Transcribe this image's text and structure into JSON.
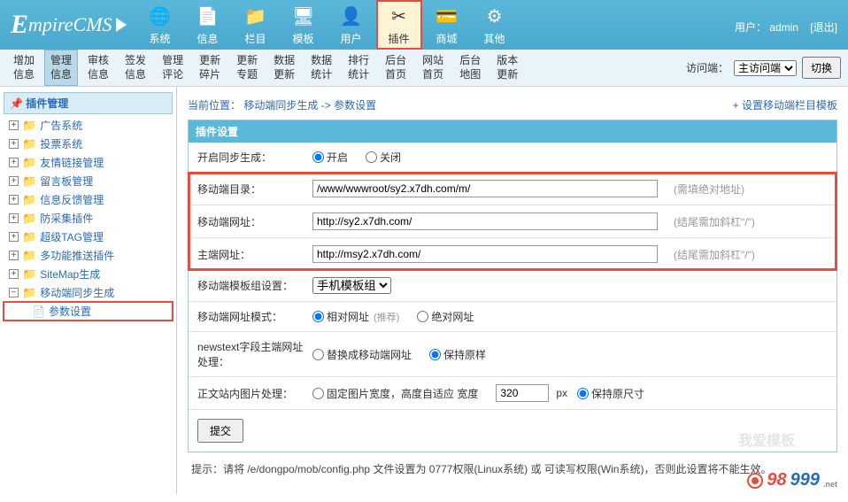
{
  "logo": "mpireCMS",
  "header_user_label": "用户：",
  "header_user": "admin",
  "header_logout": "[退出]",
  "top_nav": [
    {
      "label": "系统",
      "icon": "🌐"
    },
    {
      "label": "信息",
      "icon": "📄"
    },
    {
      "label": "栏目",
      "icon": "📁"
    },
    {
      "label": "模板",
      "icon": "🖥"
    },
    {
      "label": "用户",
      "icon": "👤"
    },
    {
      "label": "插件",
      "icon": "✂",
      "active": true
    },
    {
      "label": "商城",
      "icon": "💳"
    },
    {
      "label": "其他",
      "icon": "⚙"
    }
  ],
  "sub_nav": [
    {
      "label": "增加信息"
    },
    {
      "label": "管理信息",
      "active": true
    },
    {
      "label": "审核信息"
    },
    {
      "label": "签发信息"
    },
    {
      "label": "管理评论"
    },
    {
      "label": "更新碎片"
    },
    {
      "label": "更新专题"
    },
    {
      "label": "数据更新"
    },
    {
      "label": "数据统计"
    },
    {
      "label": "排行统计"
    },
    {
      "label": "后台首页"
    },
    {
      "label": "网站首页"
    },
    {
      "label": "后台地图"
    },
    {
      "label": "版本更新"
    }
  ],
  "visit_label": "访问端：",
  "visit_select": "主访问端",
  "visit_switch": "切换",
  "sidebar": {
    "title": "插件管理",
    "items": [
      {
        "label": "广告系统"
      },
      {
        "label": "投票系统"
      },
      {
        "label": "友情链接管理"
      },
      {
        "label": "留言板管理"
      },
      {
        "label": "信息反馈管理"
      },
      {
        "label": "防采集插件"
      },
      {
        "label": "超级TAG管理"
      },
      {
        "label": "多功能推送插件"
      },
      {
        "label": "SiteMap生成"
      },
      {
        "label": "移动端同步生成",
        "expanded": true,
        "children": [
          {
            "label": "参数设置",
            "selected": true
          }
        ]
      }
    ]
  },
  "breadcrumb": {
    "prefix": "当前位置：",
    "path1": "移动端同步生成",
    "sep": " -> ",
    "path2": "参数设置",
    "right": "+ 设置移动端栏目模板"
  },
  "panel_title": "插件设置",
  "form": {
    "enable": {
      "label": "开启同步生成：",
      "opt_on": "开启",
      "opt_off": "关闭"
    },
    "dir": {
      "label": "移动端目录：",
      "value": "/www/wwwroot/sy2.x7dh.com/m/",
      "hint": "(需填绝对地址)"
    },
    "url": {
      "label": "移动端网址：",
      "value": "http://sy2.x7dh.com/",
      "hint": "(结尾需加斜杠\"/\")"
    },
    "main_url": {
      "label": "主端网址：",
      "value": "http://msy2.x7dh.com/",
      "hint": "(结尾需加斜杠\"/\")"
    },
    "tpl": {
      "label": "移动端模板组设置：",
      "value": "手机模板组"
    },
    "url_mode": {
      "label": "移动端网址模式：",
      "opt_rel": "相对网址",
      "rec": "(推荐)",
      "opt_abs": "绝对网址"
    },
    "newstext": {
      "label": "newstext字段主端网址处理：",
      "opt_replace": "替换成移动端网址",
      "opt_keep": "保持原样"
    },
    "img": {
      "label": "正文站内图片处理：",
      "opt_fixed": "固定图片宽度，高度自适应 宽度",
      "width": "320",
      "px": " px",
      "opt_keep": "保持原尺寸"
    },
    "submit": "提交"
  },
  "tip": "提示：请将 /e/dongpo/mob/config.php 文件设置为 0777权限(Linux系统) 或 可读写权限(Win系统)，否则此设置将不能生效。",
  "watermark": "我爱模板",
  "footer": {
    "a": "98",
    "b": "999",
    "net": ".net"
  }
}
